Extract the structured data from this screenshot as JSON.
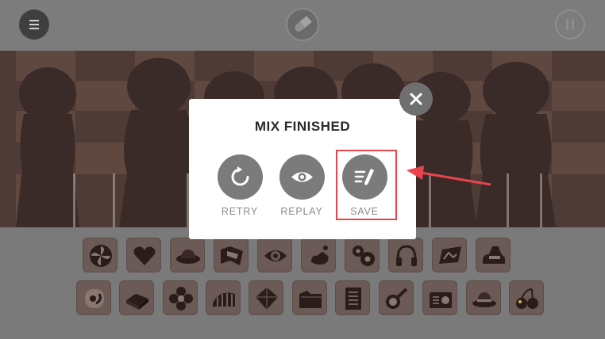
{
  "top_bar": {
    "menu_icon": "hamburger-menu-icon",
    "center_icon": "pill-icon",
    "pause_icon": "pause-icon"
  },
  "modal": {
    "title": "MIX FINISHED",
    "actions": [
      {
        "label": "RETRY",
        "icon": "retry-icon"
      },
      {
        "label": "REPLAY",
        "icon": "eye-icon"
      },
      {
        "label": "SAVE",
        "icon": "save-edit-icon"
      }
    ],
    "close_icon": "close-icon"
  },
  "annotation": {
    "highlight_color": "#e8434e",
    "target": "SAVE"
  },
  "sound_icons": {
    "row1": [
      "fan-icon",
      "heart-icon",
      "hat-icon",
      "flag-icon",
      "eye-icon",
      "splash-icon",
      "gears-icon",
      "headphones-icon",
      "picture-icon",
      "shoe-icon"
    ],
    "row2": [
      "cheek-icon",
      "box-icon",
      "flower-icon",
      "cage-icon",
      "gem-icon",
      "folder-icon",
      "notebook-icon",
      "magnifier-icon",
      "radio-icon",
      "fedora-icon",
      "cherries-icon"
    ]
  }
}
